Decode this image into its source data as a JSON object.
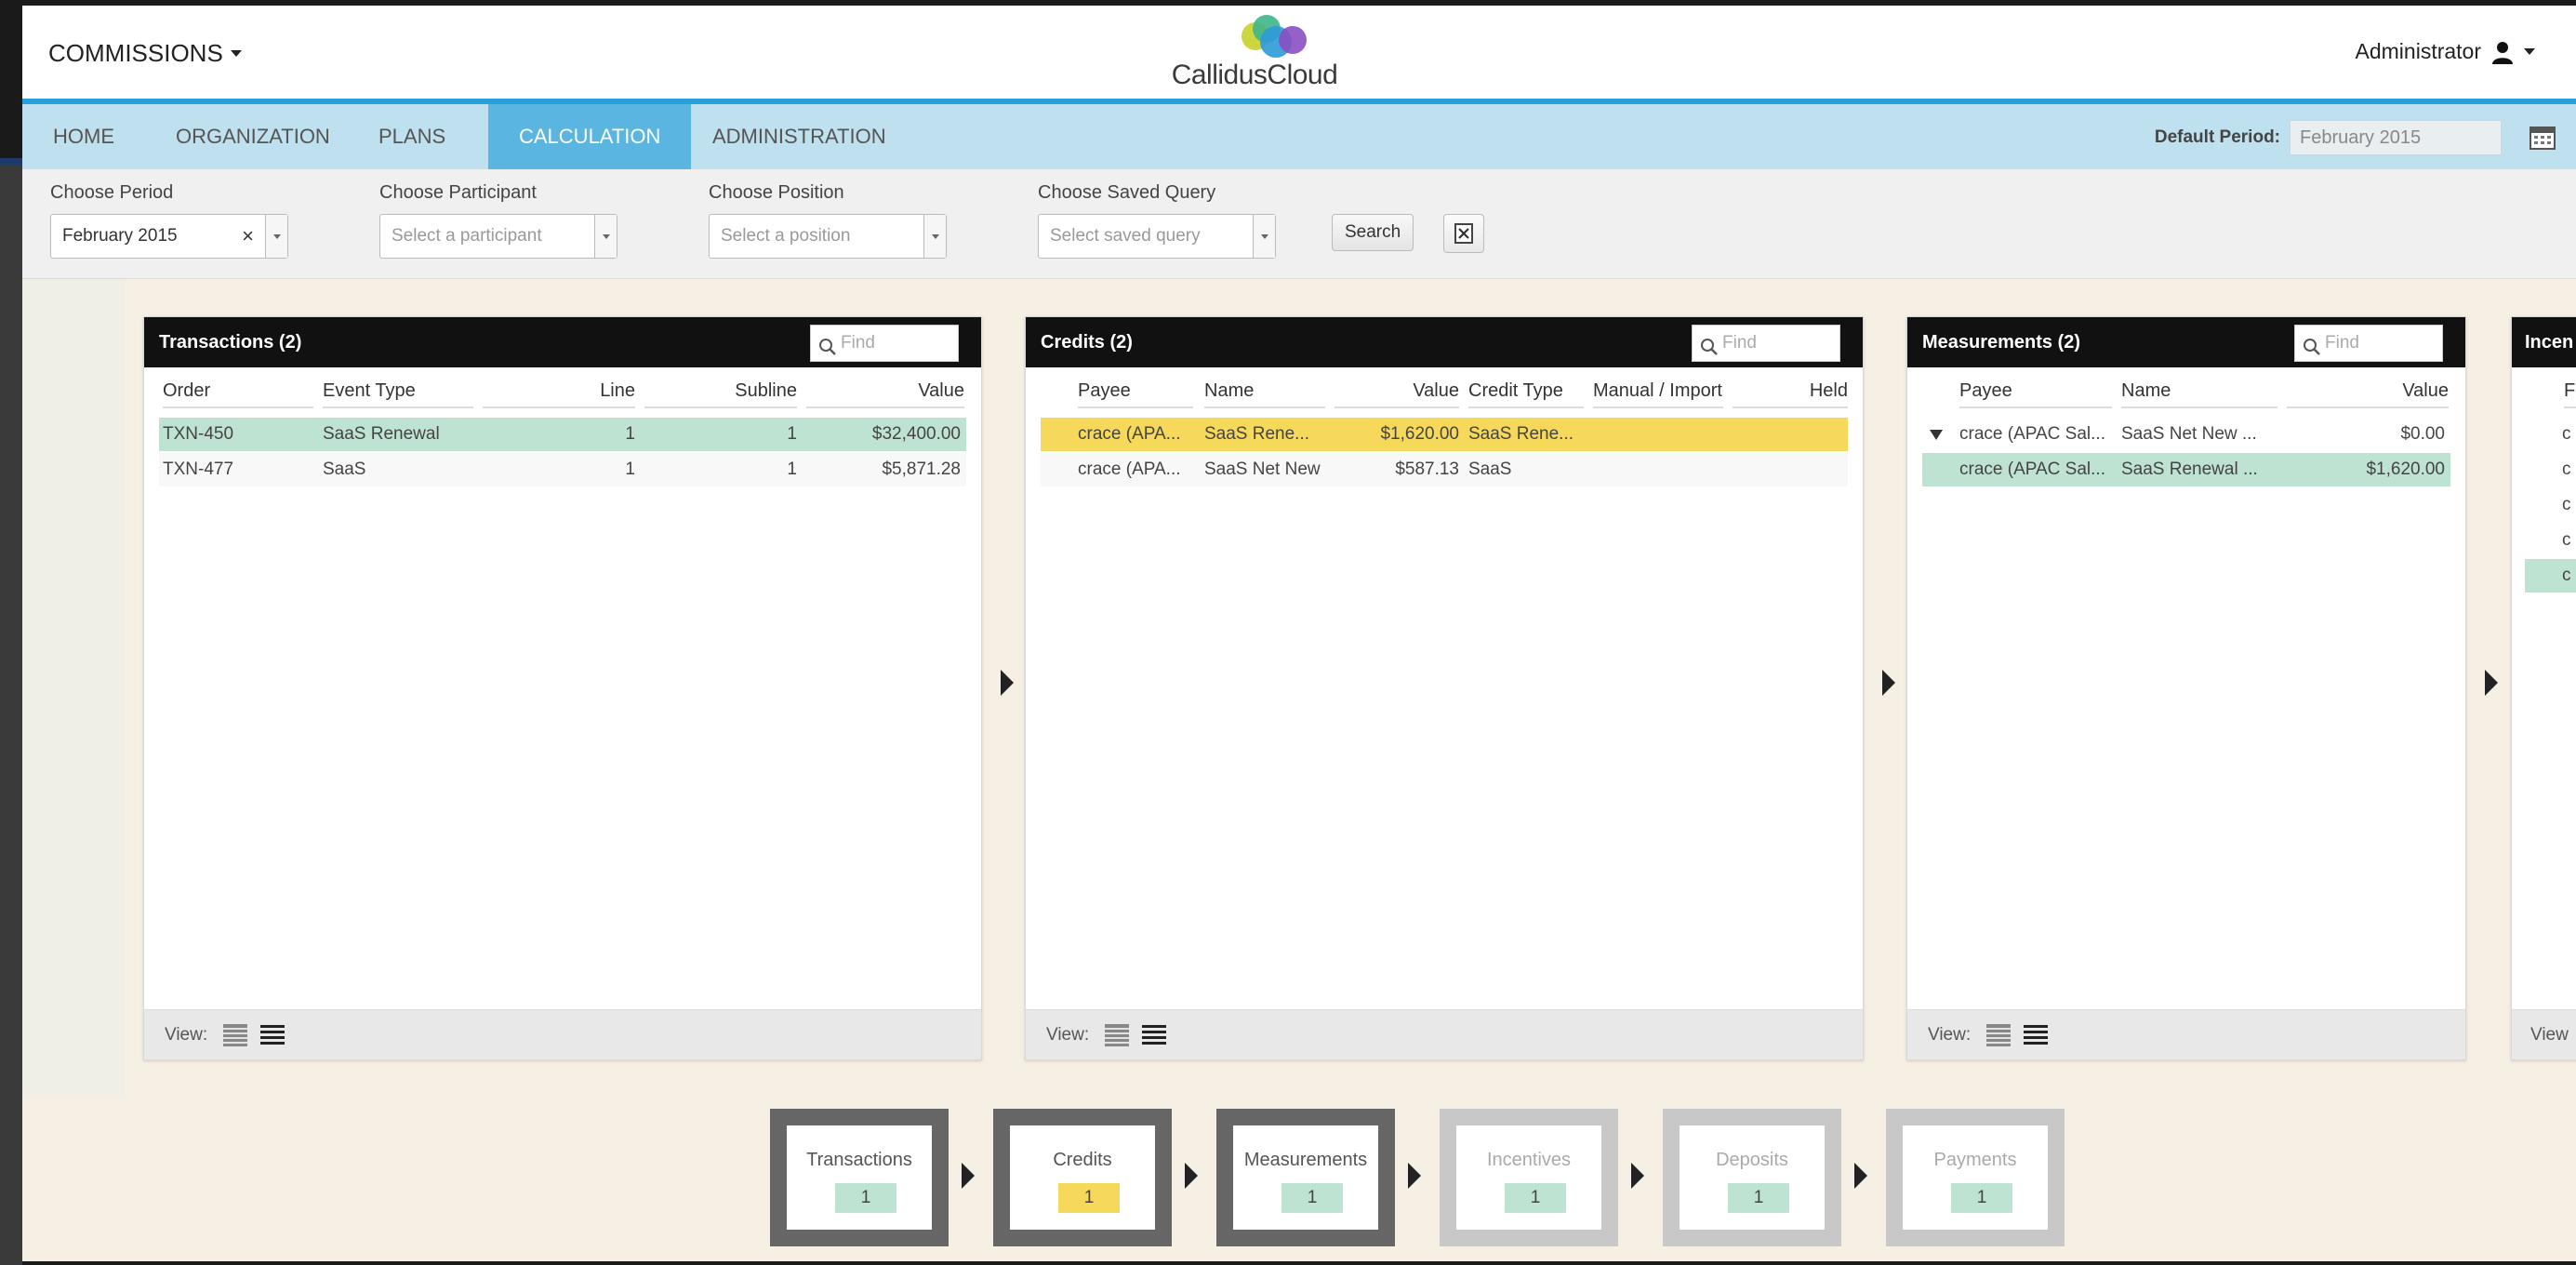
{
  "header": {
    "module": "COMMISSIONS",
    "logo_text": "CallidusCloud",
    "user": "Administrator"
  },
  "nav": {
    "items": [
      "HOME",
      "ORGANIZATION",
      "PLANS",
      "CALCULATION",
      "ADMINISTRATION"
    ],
    "active": "CALCULATION",
    "default_period_label": "Default Period:",
    "default_period_value": "February 2015"
  },
  "filters": {
    "period": {
      "label": "Choose Period",
      "value": "February 2015",
      "clear": "×"
    },
    "participant": {
      "label": "Choose Participant",
      "placeholder": "Select a participant"
    },
    "position": {
      "label": "Choose Position",
      "placeholder": "Select a position"
    },
    "saved_query": {
      "label": "Choose Saved Query",
      "placeholder": "Select saved query"
    },
    "search_label": "Search",
    "export_icon": "excel-icon"
  },
  "panels": {
    "find_placeholder": "Find",
    "view_label": "View:",
    "transactions": {
      "title": "Transactions (2)",
      "columns": [
        "Order",
        "Event Type",
        "Line",
        "Subline",
        "Value"
      ],
      "rows": [
        {
          "order": "TXN-450",
          "event_type": "SaaS Renewal",
          "line": "1",
          "subline": "1",
          "value": "$32,400.00"
        },
        {
          "order": "TXN-477",
          "event_type": "SaaS",
          "line": "1",
          "subline": "1",
          "value": "$5,871.28"
        }
      ]
    },
    "credits": {
      "title": "Credits (2)",
      "columns": [
        "Payee",
        "Name",
        "Value",
        "Credit Type",
        "Manual / Imported",
        "Held"
      ],
      "rows": [
        {
          "payee": "crace (APA...",
          "name": "SaaS Rene...",
          "value": "$1,620.00",
          "credit_type": "SaaS Rene...",
          "manual": "",
          "held": ""
        },
        {
          "payee": "crace (APA...",
          "name": "SaaS Net New",
          "value": "$587.13",
          "credit_type": "SaaS",
          "manual": "",
          "held": ""
        }
      ]
    },
    "measurements": {
      "title": "Measurements (2)",
      "columns": [
        "Payee",
        "Name",
        "Value"
      ],
      "rows": [
        {
          "payee": "crace (APAC Sal...",
          "name": "SaaS Net New ...",
          "value": "$0.00"
        },
        {
          "payee": "crace (APAC Sal...",
          "name": "SaaS Renewal ...",
          "value": "$1,620.00"
        }
      ]
    },
    "incentives_partial": {
      "title": "Incen",
      "column_partial": "F",
      "row_partial": [
        "c",
        "c",
        "c",
        "c",
        "c"
      ],
      "view_partial": "View"
    }
  },
  "flow": [
    {
      "label": "Transactions",
      "count": "1",
      "state": "active"
    },
    {
      "label": "Credits",
      "count": "1",
      "state": "active-yellow"
    },
    {
      "label": "Measurements",
      "count": "1",
      "state": "active"
    },
    {
      "label": "Incentives",
      "count": "1",
      "state": "dim"
    },
    {
      "label": "Deposits",
      "count": "1",
      "state": "dim"
    },
    {
      "label": "Payments",
      "count": "1",
      "state": "dim"
    }
  ],
  "colors": {
    "accent_blue": "#27a1db",
    "nav_bg": "#bfe0ee",
    "selected_green": "#bfe3d2",
    "selected_yellow": "#f6d95b"
  }
}
